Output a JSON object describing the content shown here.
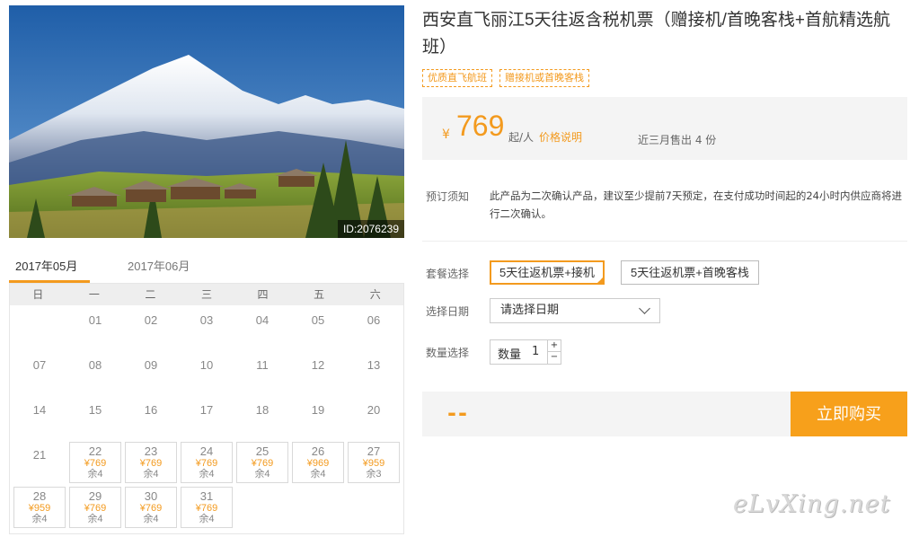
{
  "product": {
    "photo_id": "ID:2076239",
    "title": "西安直飞丽江5天往返含税机票（赠接机/首晚客栈+首航精选航班）",
    "tags": [
      "优质直飞航班",
      "赠接机或首晚客栈"
    ]
  },
  "price": {
    "currency": "¥",
    "amount": "769",
    "per": "起/人",
    "note_link": "价格说明",
    "sold": "近三月售出 4 份"
  },
  "notice": {
    "label": "预订须知",
    "text": "此产品为二次确认产品，建议至少提前7天预定，在支付成功时间起的24小时内供应商将进行二次确认。"
  },
  "packages": {
    "label": "套餐选择",
    "options": [
      "5天往返机票+接机",
      "5天往返机票+首晚客栈"
    ],
    "selected": 0
  },
  "date_select": {
    "label": "选择日期",
    "value": "请选择日期"
  },
  "quantity": {
    "label": "数量选择",
    "field_label": "数量",
    "value": "1",
    "plus": "+",
    "minus": "−"
  },
  "buy": {
    "total": "--",
    "button": "立即购买"
  },
  "calendar": {
    "tabs": [
      "2017年05月",
      "2017年06月"
    ],
    "active_tab": 0,
    "weekdays": [
      "日",
      "一",
      "二",
      "三",
      "四",
      "五",
      "六"
    ],
    "days": [
      {
        "day": ""
      },
      {
        "day": "01"
      },
      {
        "day": "02"
      },
      {
        "day": "03"
      },
      {
        "day": "04"
      },
      {
        "day": "05"
      },
      {
        "day": "06"
      },
      {
        "day": "07"
      },
      {
        "day": "08"
      },
      {
        "day": "09"
      },
      {
        "day": "10"
      },
      {
        "day": "11"
      },
      {
        "day": "12"
      },
      {
        "day": "13"
      },
      {
        "day": "14"
      },
      {
        "day": "15"
      },
      {
        "day": "16"
      },
      {
        "day": "17"
      },
      {
        "day": "18"
      },
      {
        "day": "19"
      },
      {
        "day": "20"
      },
      {
        "day": "21"
      },
      {
        "day": "22",
        "price": "¥769",
        "left": "余4"
      },
      {
        "day": "23",
        "price": "¥769",
        "left": "余4"
      },
      {
        "day": "24",
        "price": "¥769",
        "left": "余4"
      },
      {
        "day": "25",
        "price": "¥769",
        "left": "余4"
      },
      {
        "day": "26",
        "price": "¥969",
        "left": "余4"
      },
      {
        "day": "27",
        "price": "¥959",
        "left": "余3"
      },
      {
        "day": "28",
        "price": "¥959",
        "left": "余4"
      },
      {
        "day": "29",
        "price": "¥769",
        "left": "余4"
      },
      {
        "day": "30",
        "price": "¥769",
        "left": "余4"
      },
      {
        "day": "31",
        "price": "¥769",
        "left": "余4"
      }
    ]
  },
  "watermark": "eLvXing.net",
  "colors": {
    "accent": "#f39a1e",
    "button": "#f7a01b",
    "panel": "#f4f4f4"
  }
}
